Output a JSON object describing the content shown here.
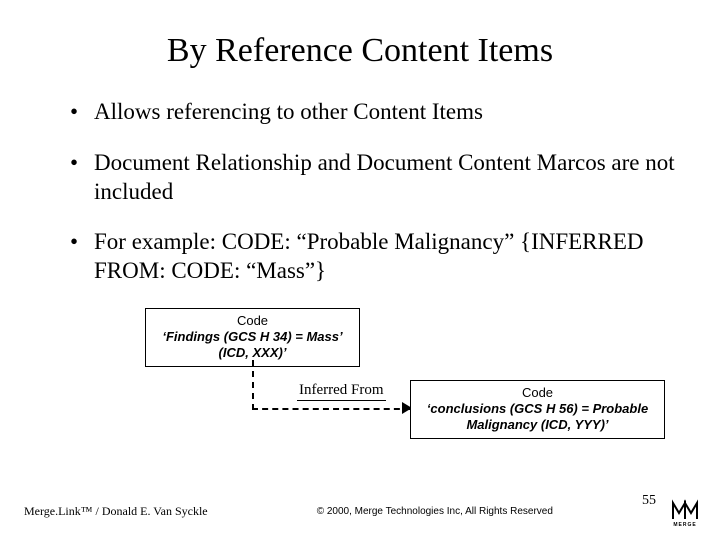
{
  "title": "By Reference Content Items",
  "bullets": [
    "Allows referencing to other Content Items",
    "Document Relationship and Document Content Marcos are not included",
    "For example:  CODE: “Probable Malignancy” {INFERRED FROM: CODE: “Mass”}"
  ],
  "diagram": {
    "left_box": {
      "l1": "Code",
      "l2_italic": "‘Findings (GCS H 34) = Mass’ (ICD, XXX)’"
    },
    "arrow_label": "Inferred From",
    "right_box": {
      "l1": "Code",
      "l2_italic": "‘conclusions (GCS H 56) = Probable Malignancy (ICD, YYY)’"
    }
  },
  "footer": {
    "left": "Merge.Link™ / Donald E. Van Syckle",
    "center": "© 2000, Merge Technologies Inc, All Rights Reserved",
    "slide_number": "55",
    "logo_text": "MERGE"
  }
}
